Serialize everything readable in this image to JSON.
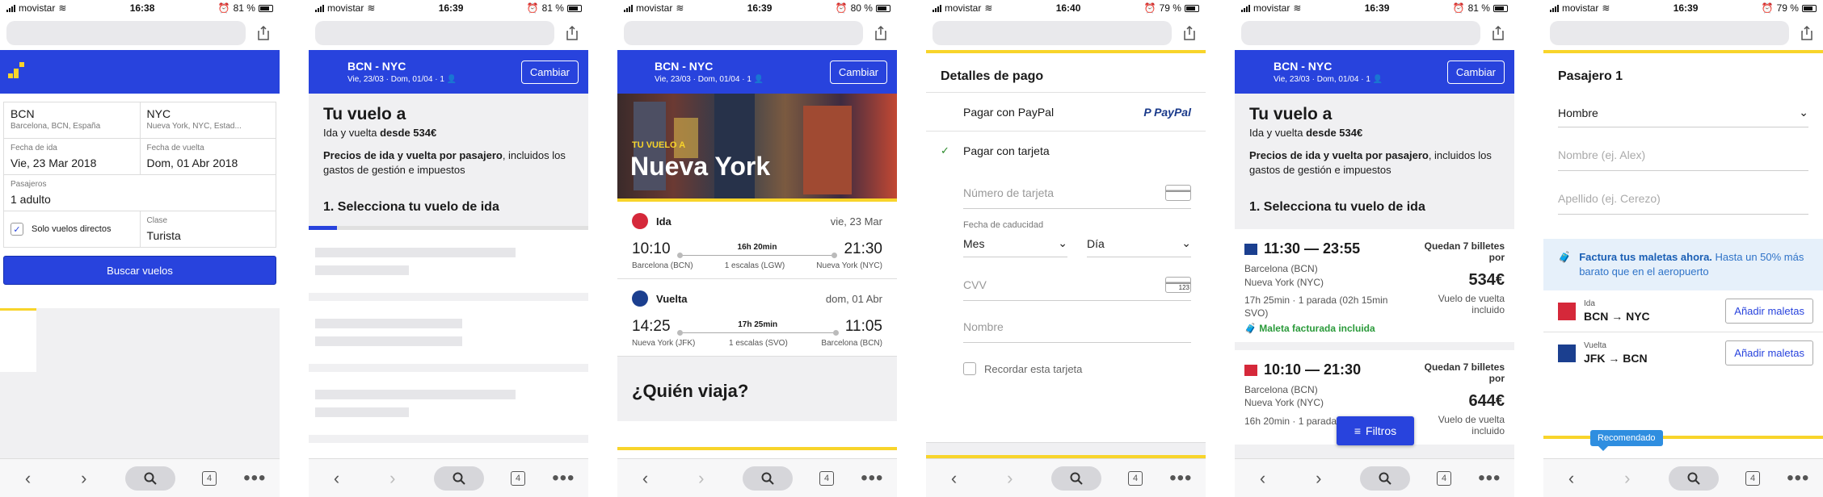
{
  "phones": [
    {
      "carrier": "movistar",
      "time": "16:38",
      "battery": "81 %"
    },
    {
      "carrier": "movistar",
      "time": "16:39",
      "battery": "81 %"
    },
    {
      "carrier": "movistar",
      "time": "16:39",
      "battery": "80 %"
    },
    {
      "carrier": "movistar",
      "time": "16:40",
      "battery": "79 %"
    },
    {
      "carrier": "movistar",
      "time": "16:39",
      "battery": "81 %"
    },
    {
      "carrier": "movistar",
      "time": "16:39",
      "battery": "79 %"
    }
  ],
  "browser": {
    "tabs_count": "4",
    "more": "•••"
  },
  "search_form": {
    "origin_code": "BCN",
    "origin_desc": "Barcelona, BCN, España",
    "dest_code": "NYC",
    "dest_desc": "Nueva York, NYC, Estad...",
    "depart_label": "Fecha de ida",
    "depart_value": "Vie, 23 Mar 2018",
    "return_label": "Fecha de vuelta",
    "return_value": "Dom, 01 Abr 2018",
    "pax_label": "Pasajeros",
    "pax_value": "1 adulto",
    "direct_label": "Solo vuelos directos",
    "class_label": "Clase",
    "class_value": "Turista",
    "search_button": "Buscar vuelos"
  },
  "trip_header": {
    "route": "BCN - NYC",
    "dates": "Vie, 23/03 · Dom, 01/04 · 1",
    "change": "Cambiar"
  },
  "results": {
    "title": "Tu vuelo a",
    "subtitle_pre": "Ida y vuelta ",
    "subtitle_price": "desde 534€",
    "desc_bold": "Precios de ida y vuelta por pasajero",
    "desc_rest": ", incluidos los gastos de gestión e impuestos",
    "select_outbound": "1. Selecciona tu vuelo de ida",
    "progress_fraction": 0.1
  },
  "summary": {
    "hero_tag": "TU VUELO A",
    "hero_city": "Nueva York",
    "outbound": {
      "label": "Ida",
      "date": "vie, 23 Mar",
      "dep": "10:10",
      "arr": "21:30",
      "duration": "16h 20min",
      "from": "Barcelona (BCN)",
      "stops": "1 escalas (LGW)",
      "to": "Nueva York (NYC)"
    },
    "inbound": {
      "label": "Vuelta",
      "date": "dom, 01 Abr",
      "dep": "14:25",
      "arr": "11:05",
      "duration": "17h 25min",
      "from": "Nueva York (JFK)",
      "stops": "1 escalas (SVO)",
      "to": "Barcelona (BCN)"
    },
    "who_travels": "¿Quién viaja?"
  },
  "payment": {
    "title": "Detalles de pago",
    "paypal_option": "Pagar con PayPal",
    "paypal_logo": "PayPal",
    "card_option": "Pagar con tarjeta",
    "card_number": "Número de tarjeta",
    "expiry_label": "Fecha de caducidad",
    "month": "Mes",
    "day": "Día",
    "cvv": "CVV",
    "cvv_icon": "123",
    "name": "Nombre",
    "remember": "Recordar esta tarjeta"
  },
  "flights": [
    {
      "times": "11:30 — 23:55",
      "from": "Barcelona (BCN)",
      "to": "Nueva York (NYC)",
      "info": "17h 25min · 1 parada (02h 15min SVO)",
      "bag": "Maleta facturada incluida",
      "quota": "Quedan 7 billetes por",
      "price": "534€",
      "price_note": "Vuelo de vuelta incluido",
      "logo_color": "#1b3f8f"
    },
    {
      "times": "10:10 — 21:30",
      "from": "Barcelona (BCN)",
      "to": "Nueva York (NYC)",
      "info": "16h 20min · 1 parada (05h",
      "bag": "",
      "quota": "Quedan 7 billetes por",
      "price": "644€",
      "price_note": "Vuelo de vuelta incluido",
      "logo_color": "#d5283a"
    }
  ],
  "filters_button": "Filtros",
  "passenger": {
    "title": "Pasajero 1",
    "gender": "Hombre",
    "first_name": "Nombre (ej. Alex)",
    "last_name": "Apellido (ej. Cerezo)",
    "promo_bold": "Factura tus maletas ahora.",
    "promo_rest": " Hasta un 50% más barato que en el aeropuerto",
    "bags": [
      {
        "dir": "Ida",
        "route": "BCN → NYC",
        "button": "Añadir maletas",
        "logo_color": "#d5283a"
      },
      {
        "dir": "Vuelta",
        "route": "JFK → BCN",
        "button": "Añadir maletas",
        "logo_color": "#1b3f8f"
      }
    ],
    "recommended": "Recomendado"
  },
  "colors": {
    "brand_blue": "#2843dd",
    "accent_yellow": "#f8d42a",
    "success_green": "#2a9a3a",
    "iberia_red": "#d5283a",
    "aeroflot_blue": "#1b3f8f"
  }
}
